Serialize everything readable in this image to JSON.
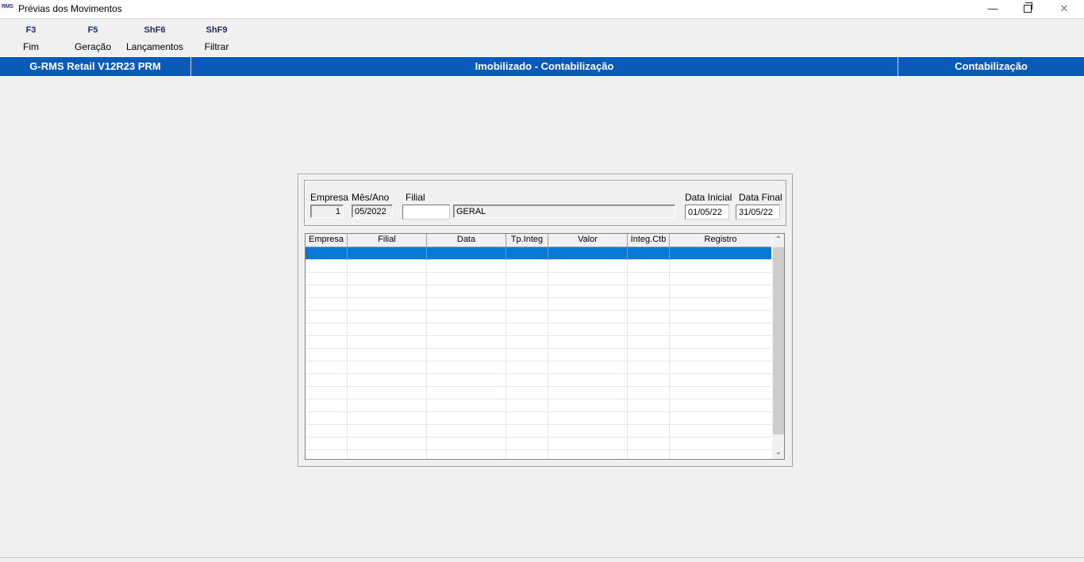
{
  "window": {
    "app_logo": "RMS",
    "title": "Prévias dos Movimentos",
    "minimize_symbol": "—",
    "close_symbol": "✕"
  },
  "toolbar": [
    {
      "key": "F3",
      "label": "Fim"
    },
    {
      "key": "F5",
      "label": "Geração"
    },
    {
      "key": "ShF6",
      "label": "Lançamentos"
    },
    {
      "key": "ShF9",
      "label": "Filtrar"
    }
  ],
  "header": {
    "left": "G-RMS Retail V12R23 PRM",
    "center": "Imobilizado - Contabilização",
    "right": "Contabilização"
  },
  "filters": {
    "empresa_label": "Empresa",
    "empresa_value": "1",
    "mes_ano_label": "Mês/Ano",
    "mes_ano_value": "05/2022",
    "filial_label": "Filial",
    "filial_code": "",
    "filial_name": "GERAL",
    "data_inicial_label": "Data Inicial",
    "data_inicial_value": "01/05/22",
    "data_final_label": "Data Final",
    "data_final_value": "31/05/22"
  },
  "grid": {
    "columns": [
      "Empresa",
      "Filial",
      "Data",
      "Tp.Integ",
      "Valor",
      "Integ.Ctb",
      "Registro"
    ],
    "scroll_up": "⌃",
    "scroll_down": "⌄"
  }
}
